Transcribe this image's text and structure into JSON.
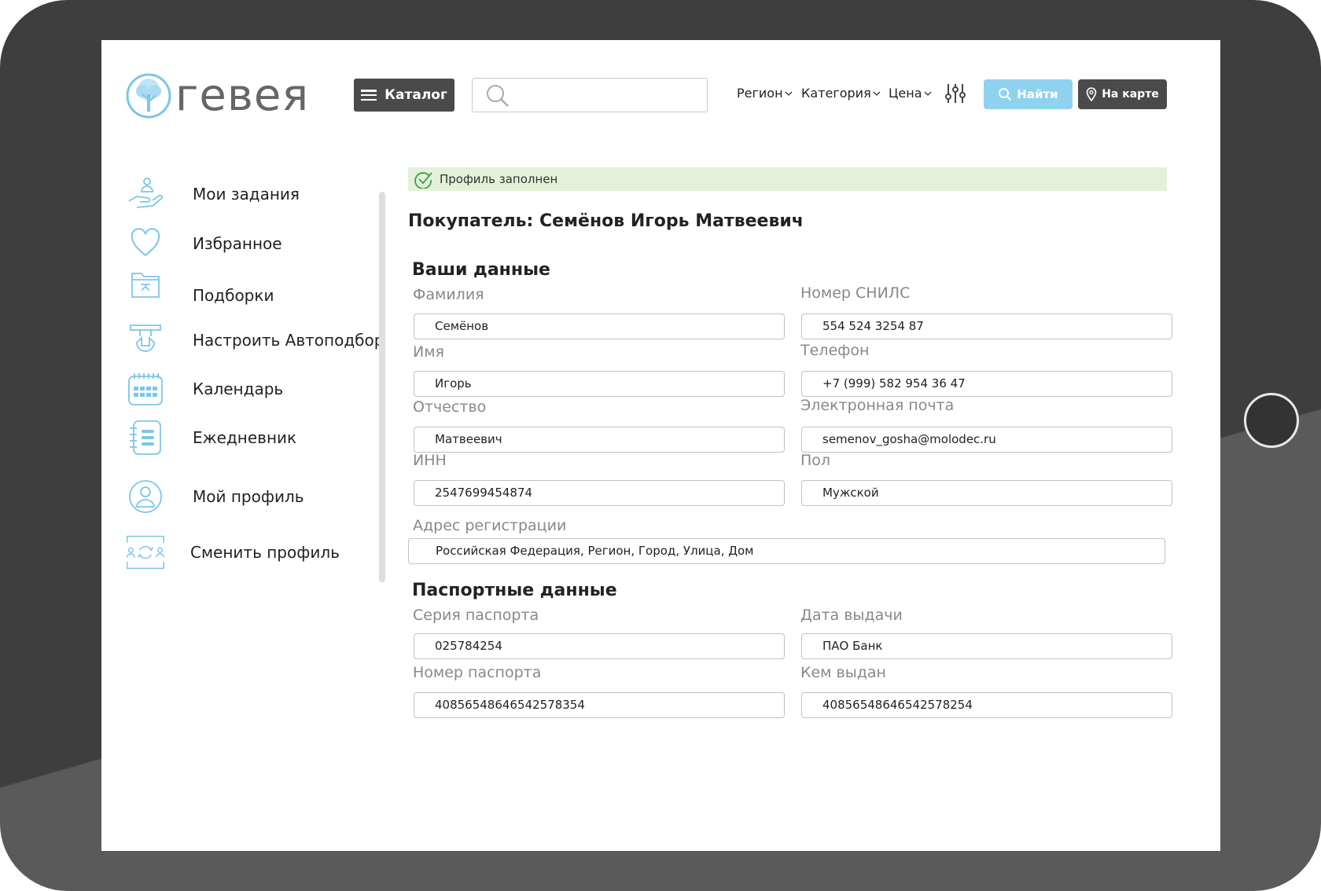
{
  "brand": {
    "name": "гевея"
  },
  "header": {
    "catalog_label": "Каталог",
    "search": {
      "value": "",
      "placeholder": ""
    },
    "filters": {
      "region": "Регион",
      "category": "Категория",
      "price": "Цена"
    },
    "find_label": "Найти",
    "map_label": "На карте"
  },
  "sidebar": {
    "items": [
      {
        "label": "Мои задания",
        "icon": "hand-task-icon"
      },
      {
        "label": "Избранное",
        "icon": "heart-icon"
      },
      {
        "label": "Подборки",
        "icon": "folder-icon"
      },
      {
        "label": "Настроить Автоподбор",
        "icon": "autoselect-icon"
      },
      {
        "label": "Календарь",
        "icon": "calendar-icon"
      },
      {
        "label": "Ежедневник",
        "icon": "notebook-icon"
      },
      {
        "label": "Мой профиль",
        "icon": "user-icon"
      },
      {
        "label": "Сменить профиль",
        "icon": "switch-profile-icon"
      }
    ]
  },
  "status": {
    "text": "Профиль заполнен"
  },
  "profile": {
    "title": "Покупатель: Семёнов Игорь Матвеевич"
  },
  "personal": {
    "title": "Ваши данные",
    "surname": {
      "label": "Фамилия",
      "value": "Семёнов"
    },
    "snils": {
      "label": "Номер СНИЛС",
      "value": "554 524 3254 87"
    },
    "name": {
      "label": "Имя",
      "value": "Игорь"
    },
    "phone": {
      "label": "Телефон",
      "value": "+7 (999) 582 954 36 47"
    },
    "patronymic": {
      "label": "Отчество",
      "value": "Матвеевич"
    },
    "email": {
      "label": "Электронная почта",
      "value": "semenov_gosha@molodec.ru"
    },
    "inn": {
      "label": "ИНН",
      "value": "2547699454874"
    },
    "gender": {
      "label": "Пол",
      "value": "Мужской"
    },
    "address": {
      "label": "Адрес регистрации",
      "value": "Российская Федерация, Регион, Город, Улица, Дом"
    }
  },
  "passport": {
    "title": "Паспортные данные",
    "series": {
      "label": "Серия паспорта",
      "value": "025784254"
    },
    "issue_date": {
      "label": "Дата выдачи",
      "value": "ПАО Банк"
    },
    "number": {
      "label": "Номер паспорта",
      "value": "40856548646542578354"
    },
    "issued_by": {
      "label": "Кем выдан",
      "value": "40856548646542578254"
    }
  },
  "colors": {
    "accent": "#8fd2ef",
    "dark": "#4a4a4a",
    "success_bg": "#e4f0d8",
    "success_icon": "#3aa34a",
    "icon_blue": "#7cc6e6"
  }
}
